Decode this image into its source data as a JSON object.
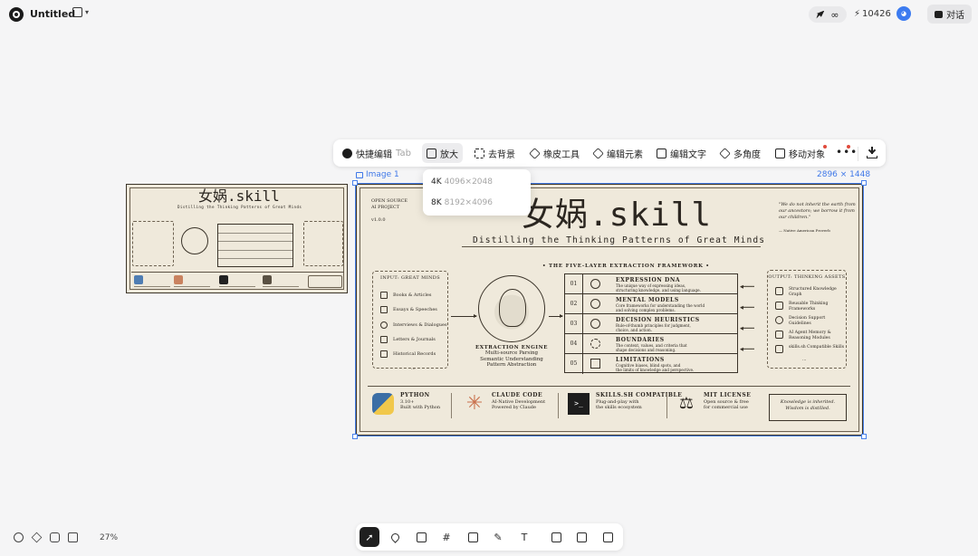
{
  "header": {
    "doc_title": "Untitled",
    "credits": "10426",
    "chat_label": "对话"
  },
  "toolbar": {
    "quick_edit": "快捷编辑",
    "quick_edit_hint": "Tab",
    "upscale": "放大",
    "remove_bg": "去背景",
    "eraser": "橡皮工具",
    "edit_elements": "编辑元素",
    "edit_text": "编辑文字",
    "multi_angle": "多角度",
    "move_object": "移动对象"
  },
  "upscale_menu": [
    {
      "label": "4K",
      "size": "4096×2048"
    },
    {
      "label": "8K",
      "size": "8192×4096"
    }
  ],
  "selection": {
    "image_label": "Image 1",
    "dimensions": "2896 × 1448"
  },
  "poster": {
    "project_lines": [
      "OPEN SOURCE",
      "AI PROJECT",
      "",
      "v1.0.0"
    ],
    "title": "女娲.skill",
    "subtitle": "Distilling the Thinking Patterns of Great Minds",
    "quote": "\"We do not inherit the earth from our ancestors; we borrow it from our children.\"",
    "quote_source": "— Native American Proverb",
    "section_title": "• THE FIVE-LAYER EXTRACTION FRAMEWORK •",
    "input": {
      "heading": "INPUT: GREAT MINDS",
      "items": [
        "Books & Articles",
        "Essays & Speeches",
        "Interviews & Dialogues",
        "Letters & Journals",
        "Historical Records"
      ],
      "more": "..."
    },
    "engine": {
      "title": "EXTRACTION ENGINE",
      "lines": [
        "Multi-source Parsing",
        "Semantic Understanding",
        "Pattern Abstraction"
      ]
    },
    "layers": [
      {
        "num": "01",
        "name": "EXPRESSION DNA",
        "desc1": "The unique way of expressing ideas,",
        "desc2": "structuring knowledge, and using language."
      },
      {
        "num": "02",
        "name": "MENTAL MODELS",
        "desc1": "Core frameworks for understanding the world",
        "desc2": "and solving complex problems."
      },
      {
        "num": "03",
        "name": "DECISION HEURISTICS",
        "desc1": "Rule-of-thumb principles for judgment,",
        "desc2": "choice, and action."
      },
      {
        "num": "04",
        "name": "BOUNDARIES",
        "desc1": "The context, values, and criteria that",
        "desc2": "shape decisions and reasoning."
      },
      {
        "num": "05",
        "name": "LIMITATIONS",
        "desc1": "Cognitive biases, blind spots, and",
        "desc2": "the limits of knowledge and perspective."
      }
    ],
    "output": {
      "heading": "OUTPUT: THINKING ASSETS",
      "items": [
        "Structured Knowledge Graph",
        "Reusable Thinking Frameworks",
        "Decision Support Guidelines",
        "AI Agent Memory & Reasoning Modules",
        "skills.sh Compatible Skills"
      ],
      "more": "..."
    },
    "features": [
      {
        "title": "PYTHON",
        "line1": "3.10+",
        "line2": "Built with Python"
      },
      {
        "title": "CLAUDE CODE",
        "line1": "AI-Native Development",
        "line2": "Powered by Claude"
      },
      {
        "title": "SKILLS.SH COMPATIBLE",
        "line1": "Plug-and-play with",
        "line2": "the skills ecosystem"
      },
      {
        "title": "MIT LICENSE",
        "line1": "Open source & free",
        "line2": "for commercial use"
      }
    ],
    "motto_1": "Knowledge is inherited.",
    "motto_2": "Wisdom is distilled."
  },
  "zoom_level": "27%",
  "colors": {
    "canvas": "#f5f5f6",
    "selection": "#4a82ec",
    "poster_bg": "#efe9db",
    "ink": "#2b2620",
    "accent_dot": "#e04a3c"
  }
}
